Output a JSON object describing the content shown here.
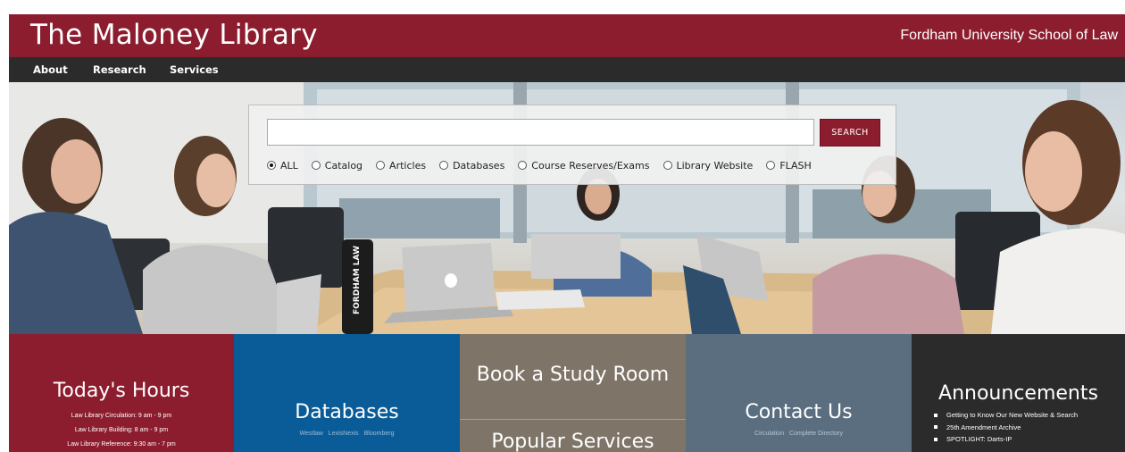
{
  "header": {
    "title": "The Maloney Library",
    "university": "Fordham University School of Law",
    "brand_color": "#8c1d2e"
  },
  "nav": {
    "items": [
      {
        "label": "About"
      },
      {
        "label": "Research"
      },
      {
        "label": "Services"
      }
    ]
  },
  "search": {
    "query": "",
    "button_label": "SEARCH",
    "scopes": [
      {
        "label": "ALL",
        "checked": true
      },
      {
        "label": "Catalog",
        "checked": false
      },
      {
        "label": "Articles",
        "checked": false
      },
      {
        "label": "Databases",
        "checked": false
      },
      {
        "label": "Course Reserves/Exams",
        "checked": false
      },
      {
        "label": "Library Website",
        "checked": false
      },
      {
        "label": "FLASH",
        "checked": false
      }
    ]
  },
  "tiles": {
    "hours": {
      "title": "Today's Hours",
      "lines": [
        "Law Library Circulation: 9 am - 9 pm",
        "Law Library Building: 8 am - 9 pm",
        "Law Library Reference: 9:30 am - 7 pm"
      ]
    },
    "databases": {
      "title": "Databases",
      "links": [
        "Westlaw",
        "LexisNexis",
        "Bloomberg"
      ]
    },
    "study_room": {
      "title": "Book a Study Room"
    },
    "popular": {
      "title": "Popular Services"
    },
    "contact": {
      "title": "Contact Us",
      "links": [
        "Circulation",
        "Complete Directory"
      ]
    },
    "announcements": {
      "title": "Announcements",
      "items": [
        "Getting to Know Our New Website & Search",
        "25th Amendment Archive",
        "SPOTLIGHT: Darts-IP"
      ]
    }
  },
  "hero": {
    "bottle_text": "FORDHAM LAW"
  }
}
